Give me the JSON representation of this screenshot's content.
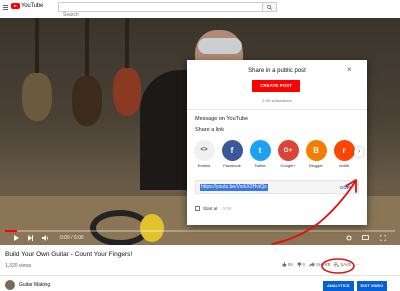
{
  "header": {
    "logo_text": "YouTube",
    "search_placeholder": "Search"
  },
  "player": {
    "time": "0:09 / 5:06",
    "progress_fraction": 0.03
  },
  "dialog": {
    "title": "Share in a public post",
    "create_post_label": "CREATE POST",
    "subscribers": "2.9K subscribers",
    "message_label": "Message on YouTube",
    "share_link_label": "Share a link",
    "targets": [
      {
        "label": "Embed",
        "glyph": "<>",
        "color": "#f0f0f0",
        "glyph_color": "#444"
      },
      {
        "label": "Facebook",
        "glyph": "f",
        "color": "#3b5998",
        "glyph_color": "#fff"
      },
      {
        "label": "Twitter",
        "glyph": "t",
        "color": "#1da1f2",
        "glyph_color": "#fff"
      },
      {
        "label": "Google+",
        "glyph": "G+",
        "color": "#db4437",
        "glyph_color": "#fff"
      },
      {
        "label": "Blogger",
        "glyph": "B",
        "color": "#f57d00",
        "glyph_color": "#fff"
      },
      {
        "label": "reddit",
        "glyph": "r",
        "color": "#ff4500",
        "glyph_color": "#fff"
      }
    ],
    "url": "https://youtu.be/VxrkX2HvtQs",
    "copy_label": "COPY",
    "start_at_label": "Start at",
    "start_at_value": "0:09"
  },
  "video": {
    "title": "Build Your Own Guitar - Count Your Fingers!",
    "views": "1,320 views",
    "likes": "59",
    "dislikes": "0",
    "share_label": "SHARE",
    "save_label": "SAVE"
  },
  "channel": {
    "name": "Guitar Making",
    "analytics_label": "ANALYTICS",
    "edit_label": "EDIT VIDEO"
  },
  "colors": {
    "accent": "#ff0000",
    "link_blue": "#065fd4",
    "annotation": "#e01010"
  }
}
